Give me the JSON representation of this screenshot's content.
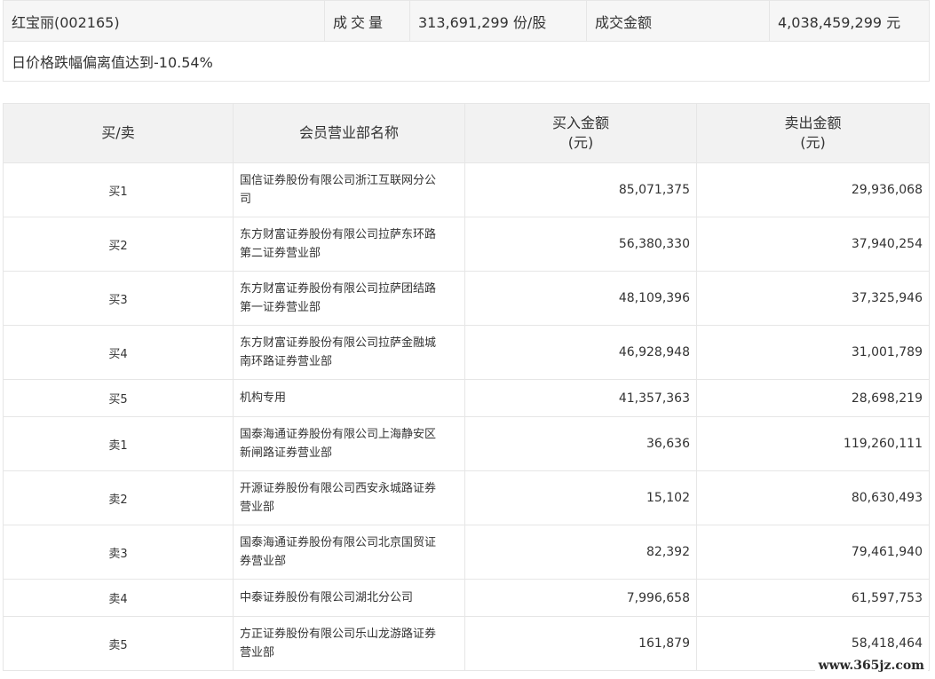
{
  "summary": {
    "stock": "红宝丽(002165)",
    "volume_label": "成交量",
    "volume_value": "313,691,299 份/股",
    "amount_label": "成交金额",
    "amount_value": "4,038,459,299 元",
    "deviation_text": "日价格跌幅偏离值达到-10.54%"
  },
  "table": {
    "headers": {
      "side": "买/卖",
      "member": "会员营业部名称",
      "buy_line1": "买入金额",
      "buy_line2": "(元)",
      "sell_line1": "卖出金额",
      "sell_line2": "(元)"
    },
    "rows": [
      {
        "side": "买1",
        "name_line1": "国信证券股份有限公司浙江互联网分公",
        "name_line2": "司",
        "buy": "85,071,375",
        "sell": "29,936,068"
      },
      {
        "side": "买2",
        "name_line1": "东方财富证券股份有限公司拉萨东环路",
        "name_line2": "第二证券营业部",
        "buy": "56,380,330",
        "sell": "37,940,254"
      },
      {
        "side": "买3",
        "name_line1": "东方财富证券股份有限公司拉萨团结路",
        "name_line2": "第一证券营业部",
        "buy": "48,109,396",
        "sell": "37,325,946"
      },
      {
        "side": "买4",
        "name_line1": "东方财富证券股份有限公司拉萨金融城",
        "name_line2": "南环路证券营业部",
        "buy": "46,928,948",
        "sell": "31,001,789"
      },
      {
        "side": "买5",
        "name_line1": "机构专用",
        "name_line2": "",
        "buy": "41,357,363",
        "sell": "28,698,219"
      },
      {
        "side": "卖1",
        "name_line1": "国泰海通证券股份有限公司上海静安区",
        "name_line2": "新闸路证券营业部",
        "buy": "36,636",
        "sell": "119,260,111"
      },
      {
        "side": "卖2",
        "name_line1": "开源证券股份有限公司西安永城路证券",
        "name_line2": "营业部",
        "buy": "15,102",
        "sell": "80,630,493"
      },
      {
        "side": "卖3",
        "name_line1": "国泰海通证券股份有限公司北京国贸证",
        "name_line2": "券营业部",
        "buy": "82,392",
        "sell": "79,461,940"
      },
      {
        "side": "卖4",
        "name_line1": "中泰证券股份有限公司湖北分公司",
        "name_line2": "",
        "buy": "7,996,658",
        "sell": "61,597,753"
      },
      {
        "side": "卖5",
        "name_line1": "方正证券股份有限公司乐山龙游路证券",
        "name_line2": "营业部",
        "buy": "161,879",
        "sell": "58,418,464"
      }
    ]
  },
  "watermark": "www.365jz.com"
}
